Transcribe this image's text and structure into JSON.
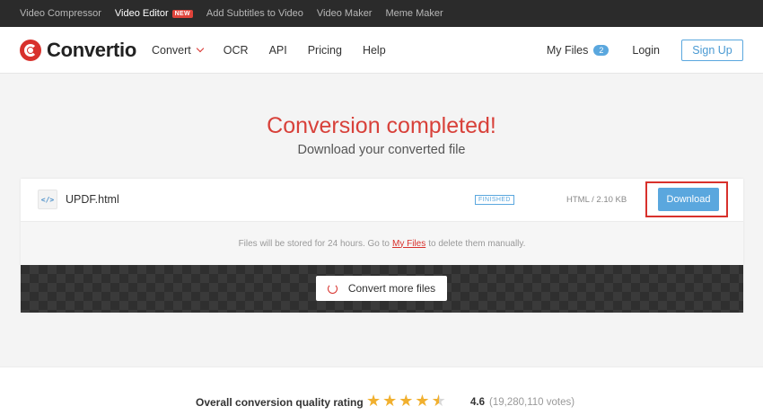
{
  "topbar": {
    "links": [
      {
        "label": "Video Compressor"
      },
      {
        "label": "Video Editor",
        "badge": "NEW"
      },
      {
        "label": "Add Subtitles to Video"
      },
      {
        "label": "Video Maker"
      },
      {
        "label": "Meme Maker"
      }
    ]
  },
  "nav": {
    "brand": "Convertio",
    "menu": [
      "Convert",
      "OCR",
      "API",
      "Pricing",
      "Help"
    ],
    "my_files": "My Files",
    "my_files_count": "2",
    "login": "Login",
    "signup": "Sign Up"
  },
  "main": {
    "title": "Conversion completed!",
    "subtitle": "Download your converted file"
  },
  "file": {
    "icon": "</>",
    "name": "UPDF.html",
    "status": "FINISHED",
    "meta": "HTML / 2.10 KB",
    "download": "Download"
  },
  "notice": {
    "before": "Files will be stored for 24 hours. Go to",
    "link": "My Files",
    "after": "to delete them manually."
  },
  "actions": {
    "convert_more": "Convert more files"
  },
  "rating": {
    "label": "Overall conversion quality rating",
    "stars": 4.6,
    "score": "4.6",
    "votes": "(19,280,110 votes)"
  },
  "colors": {
    "brand_red": "#d8312c",
    "accent_blue": "#5aa7de"
  }
}
